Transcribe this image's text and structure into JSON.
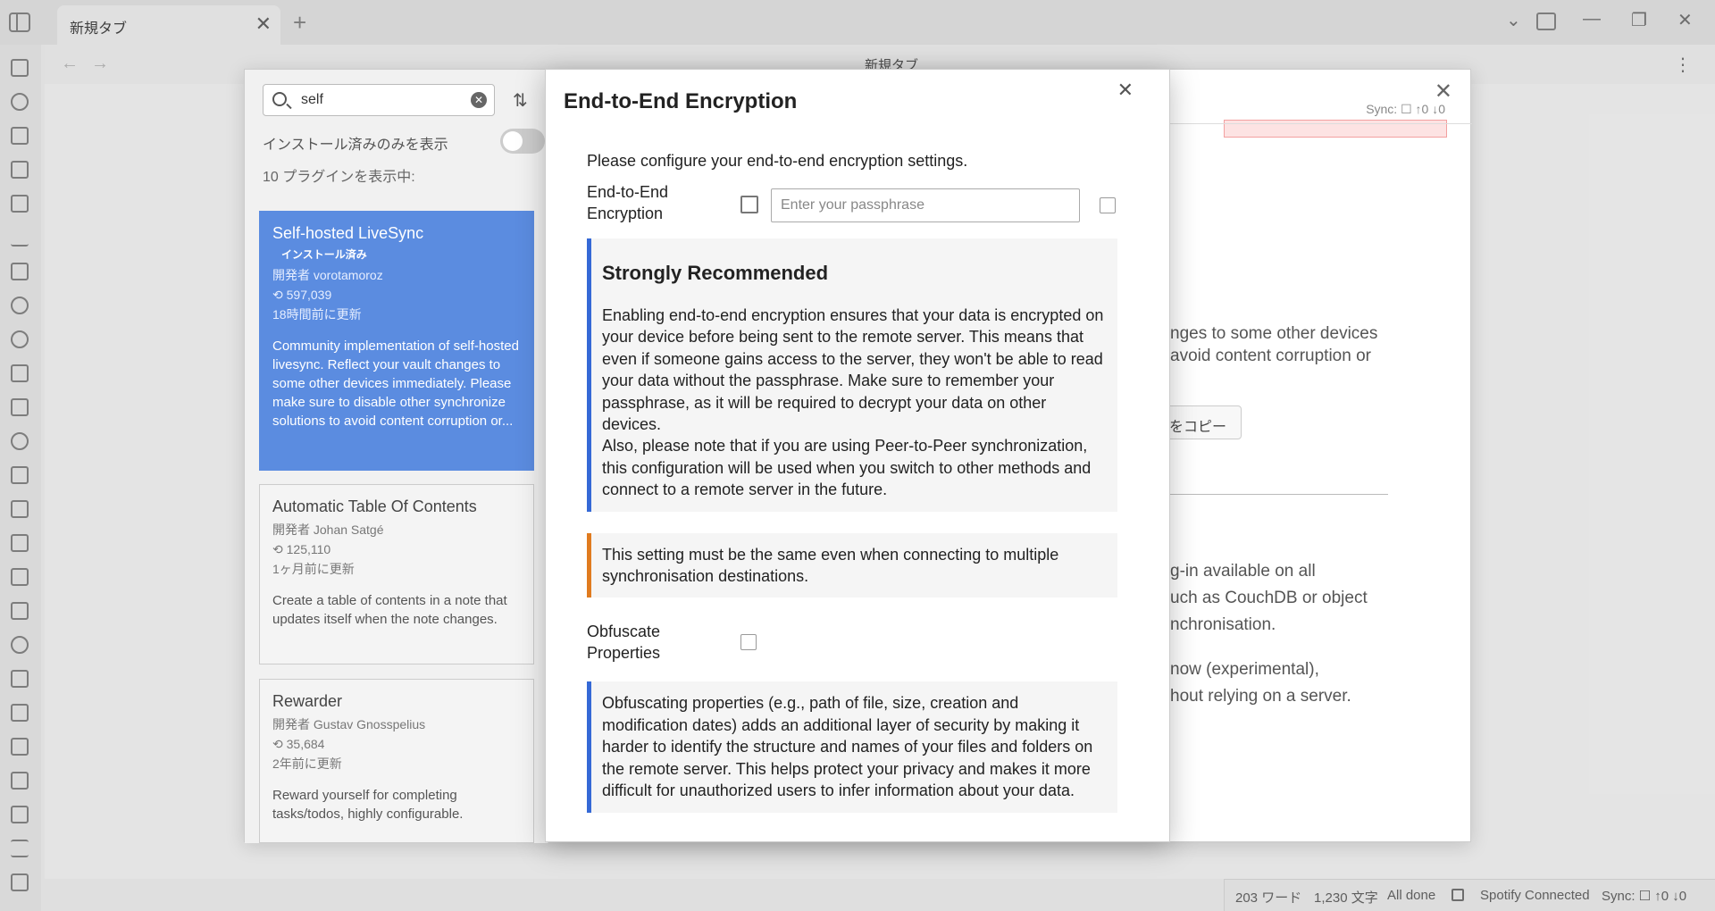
{
  "titlebar": {
    "tab_title": "新規タブ",
    "tab_close": "✕",
    "tab_add": "+",
    "chevron": "⌄",
    "minimize": "—",
    "restore": "❐",
    "close": "✕"
  },
  "navbar": {
    "back": "←",
    "forward": "→",
    "title": "新規タブ",
    "more": "⋮"
  },
  "plugins": {
    "search_value": "self",
    "installed_only_label": "インストール済みのみを表示",
    "count_label": "10 プラグインを表示中:",
    "items": [
      {
        "name": "Self-hosted LiveSync",
        "badge": "インストール済み",
        "author": "開発者 vorotamoroz",
        "downloads": "⟲ 597,039",
        "updated": "18時間前に更新",
        "desc": "Community implementation of self-hosted livesync. Reflect your vault changes to some other devices immediately. Please make sure to disable other synchronize solutions to avoid content corruption or..."
      },
      {
        "name": "Automatic Table Of Contents",
        "author": "開発者 Johan Satgé",
        "downloads": "⟲ 125,110",
        "updated": "1ヶ月前に更新",
        "desc": "Create a table of contents in a note that updates itself when the note changes."
      },
      {
        "name": "Rewarder",
        "author": "開発者 Gustav Gnosspelius",
        "downloads": "⟲ 35,684",
        "updated": "2年前に更新",
        "desc": "Reward yourself for completing tasks/todos, highly configurable."
      }
    ]
  },
  "detail": {
    "sync_status": "Sync: ☐ ↑0 ↓0",
    "line1": "nges to some other devices",
    "line2": "avoid content corruption or",
    "copy_button": "をコピー",
    "line3": "g-in available on all",
    "line4": "uch as CouchDB or object",
    "line5": "nchronisation.",
    "line6": "now (experimental),",
    "line7": "hout relying on a server."
  },
  "e2e": {
    "title": "End-to-End Encryption",
    "close": "✕",
    "intro": "Please configure your end-to-end encryption settings.",
    "e2e_label": "End-to-End Encryption",
    "passphrase_placeholder": "Enter your passphrase",
    "recommend_title": "Strongly Recommended",
    "recommend_text_1": "Enabling end-to-end encryption ensures that your data is encrypted on your device before being sent to the remote server. This means that even if someone gains access to the server, they won't be able to read your data without the passphrase. Make sure to remember your passphrase, as it will be required to decrypt your data on other devices.",
    "recommend_text_2": "Also, please note that if you are using Peer-to-Peer synchronization, this configuration will be used when you switch to other methods and connect to a remote server in the future.",
    "warning_text": "This setting must be the same even when connecting to multiple synchronisation destinations.",
    "obfuscate_label": "Obfuscate Properties",
    "obfuscate_text": "Obfuscating properties (e.g., path of file, size, creation and modification dates) adds an additional layer of security by making it harder to identify the structure and names of your files and folders on the remote server. This helps protect your privacy and makes it more difficult for unauthorized users to infer information about your data."
  },
  "statusbar": {
    "words": "203 ワード",
    "chars": "1,230 文字",
    "all_done": "All done",
    "spotify": "Spotify Connected",
    "sync": "Sync: ☐ ↑0 ↓0"
  },
  "colors": {
    "accent": "#5b8ce0",
    "callout_info": "#3569d6",
    "callout_warn": "#e07b1f"
  }
}
